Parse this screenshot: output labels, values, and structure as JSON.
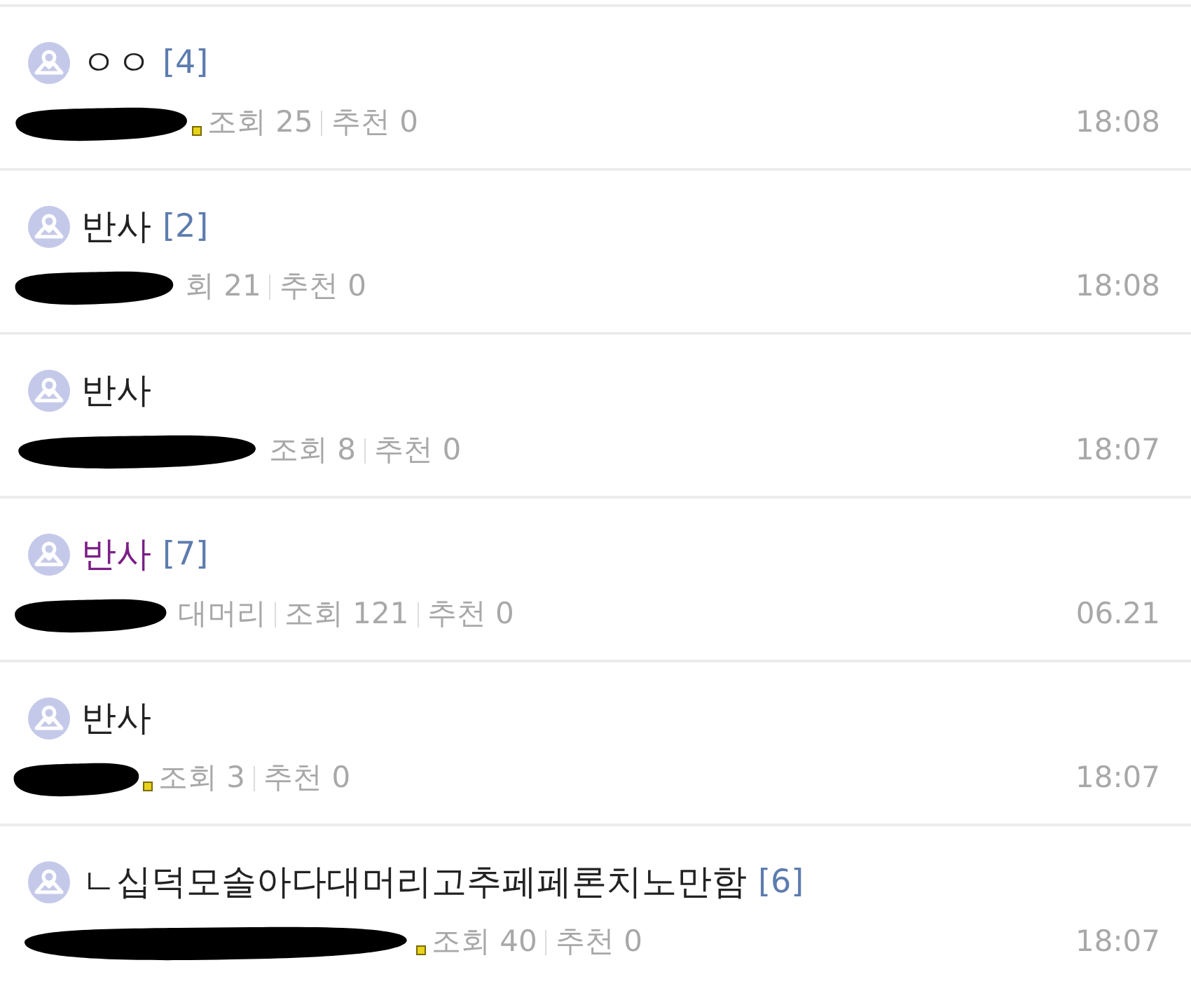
{
  "posts": [
    {
      "title": "ㅇㅇ",
      "comments": "[4]",
      "visited": false,
      "badge": true,
      "meta": [
        "조회 25",
        "추천 0"
      ],
      "time": "18:08"
    },
    {
      "title": "반사",
      "comments": "[2]",
      "visited": false,
      "badge": false,
      "meta": [
        "회 21",
        "추천 0"
      ],
      "time": "18:08"
    },
    {
      "title": "반사",
      "visited": false,
      "badge": false,
      "meta": [
        "조회 8",
        "추천 0"
      ],
      "time": "18:07"
    },
    {
      "title": "반사",
      "comments": "[7]",
      "visited": true,
      "badge": false,
      "meta": [
        "대머리",
        "조회 121",
        "추천 0"
      ],
      "time": "06.21"
    },
    {
      "title": "반사",
      "visited": false,
      "badge": true,
      "meta": [
        "조회 3",
        "추천 0"
      ],
      "time": "18:07"
    },
    {
      "title": "ㄴ십덕모솔아다대머리고추페페론치노만함",
      "comments": "[6]",
      "visited": false,
      "badge": true,
      "meta": [
        "조회 40",
        "추천 0"
      ],
      "time": "18:07"
    }
  ]
}
